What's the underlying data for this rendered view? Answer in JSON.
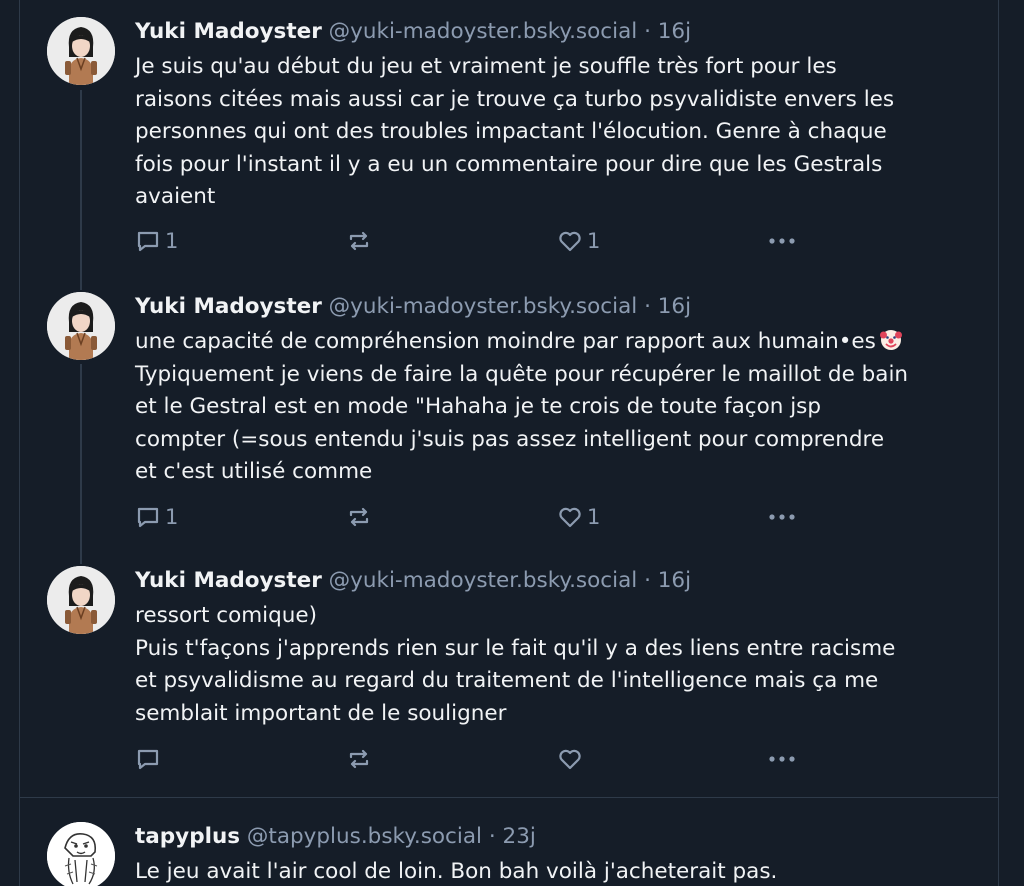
{
  "posts": [
    {
      "author": "Yuki Madoyster",
      "handle": "@yuki-madoyster.bsky.social",
      "separator": "·",
      "time": "16j",
      "lines": [
        "Je suis qu'au début du jeu et vraiment je souffle très fort pour les",
        "raisons citées mais aussi car je trouve ça turbo psyvalidiste envers les",
        "personnes qui ont des troubles impactant l'élocution. Genre à chaque",
        "fois pour l'instant il y a eu un commentaire pour dire que les Gestrals",
        "avaient"
      ],
      "reply_count": "1",
      "like_count": "1",
      "icons": [
        "reply-icon",
        "repost-icon",
        "like-icon",
        "more-icon"
      ]
    },
    {
      "author": "Yuki Madoyster",
      "handle": "@yuki-madoyster.bsky.social",
      "separator": "·",
      "time": "16j",
      "lines": [
        "une capacité de compréhension moindre par rapport aux humain•es",
        "Typiquement je viens de faire la quête pour récupérer le maillot de bain",
        "et le Gestral est en mode \"Hahaha je te crois de toute façon jsp",
        "compter (=sous entendu j'suis pas assez intelligent pour comprendre",
        "et c'est utilisé comme"
      ],
      "emoji": "clown-face-emoji",
      "reply_count": "1",
      "like_count": "1",
      "icons": [
        "reply-icon",
        "repost-icon",
        "like-icon",
        "more-icon"
      ]
    },
    {
      "author": "Yuki Madoyster",
      "handle": "@yuki-madoyster.bsky.social",
      "separator": "·",
      "time": "16j",
      "lines": [
        "ressort comique)",
        "Puis t'façons j'apprends rien sur le fait qu'il y a des liens entre racisme",
        "et psyvalidisme au regard du traitement de l'intelligence mais ça me",
        "semblait important de le souligner"
      ],
      "reply_count": "",
      "like_count": "",
      "icons": [
        "reply-icon",
        "repost-icon",
        "like-icon",
        "more-icon"
      ]
    },
    {
      "author": "tapyplus",
      "handle": "@tapyplus.bsky.social",
      "separator": "·",
      "time": "23j",
      "lines": [
        "Le jeu avait l'air cool de loin. Bon bah voilà j'acheterait pas."
      ]
    }
  ],
  "colors": {
    "background": "#151d28",
    "text": "#f1f3f5",
    "muted": "#8c9bb0",
    "border": "#2e3a49"
  }
}
